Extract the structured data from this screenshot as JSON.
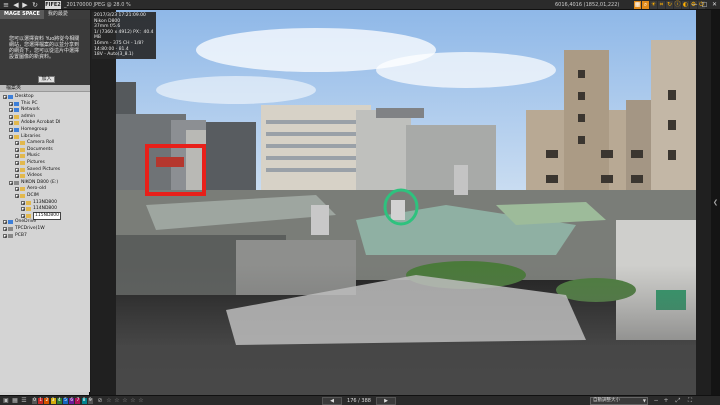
{
  "topbar": {
    "mode_label": "FIFE2",
    "file_title": "_20170000 JPEG @ 28.0 %",
    "image_info": "6016,4016 (1852,01,222)",
    "tool_icons": [
      "grid-icon",
      "zoom-icon",
      "sun-icon",
      "crop-icon",
      "rotate-icon",
      "info-icon",
      "palette-icon",
      "settings-icon",
      "exit-icon"
    ],
    "win_buttons": [
      "—",
      "□",
      "✕"
    ]
  },
  "left_panel": {
    "tabs": [
      "MAGE SPACE",
      "我的最愛"
    ],
    "note_text": "您可以選擇資料 Yuo將從今相關網站，您選擇檔案的以並分享到的網頁下，您可以從這片中選擇設置圖像的新資料。",
    "note_button": "加入",
    "tree_header": "檔案夾",
    "tree": [
      {
        "label": "Desktop",
        "depth": 0,
        "icon": "blue"
      },
      {
        "label": "This PC",
        "depth": 1,
        "icon": "blue"
      },
      {
        "label": "Network",
        "depth": 1,
        "icon": "blue"
      },
      {
        "label": "admin",
        "depth": 1,
        "icon": "yellow"
      },
      {
        "label": "Adobe Acrobat DI",
        "depth": 1,
        "icon": "yellow"
      },
      {
        "label": "Homegroup",
        "depth": 1,
        "icon": "blue"
      },
      {
        "label": "Libraries",
        "depth": 1,
        "icon": "yellow"
      },
      {
        "label": "Camera Roll",
        "depth": 2,
        "icon": "yellow"
      },
      {
        "label": "Documents",
        "depth": 2,
        "icon": "yellow"
      },
      {
        "label": "Music",
        "depth": 2,
        "icon": "yellow"
      },
      {
        "label": "Pictures",
        "depth": 2,
        "icon": "yellow"
      },
      {
        "label": "Saved Pictures",
        "depth": 2,
        "icon": "yellow"
      },
      {
        "label": "Videos",
        "depth": 2,
        "icon": "yellow"
      },
      {
        "label": "NIKON D800 (E:)",
        "depth": 1,
        "icon": "grey"
      },
      {
        "label": "Aero-old",
        "depth": 2,
        "icon": "yellow"
      },
      {
        "label": "DCIM",
        "depth": 2,
        "icon": "yellow"
      },
      {
        "label": "113ND800",
        "depth": 3,
        "icon": "yellow"
      },
      {
        "label": "114ND800",
        "depth": 3,
        "icon": "yellow"
      },
      {
        "label": "115ND800",
        "depth": 3,
        "icon": "yellow",
        "selected": true
      },
      {
        "label": "OneDrive",
        "depth": 0,
        "icon": "blue"
      },
      {
        "label": "TPCDrive(1W",
        "depth": 0,
        "icon": "grey"
      },
      {
        "label": "PCB7",
        "depth": 0,
        "icon": "grey"
      }
    ]
  },
  "info_box": {
    "lines": [
      "2017/3/23 17:21:09.00",
      "Nikon D800",
      "37mm f/5.6",
      "1/ (7360 x 4912)  PX：40.4 MB",
      "16mm - 375 CH - 1/8?",
      "14:80:00 - 81.4",
      "18V - Auto(3_8.1)"
    ]
  },
  "bottombar": {
    "ratings": [
      "0",
      "1",
      "2",
      "3",
      "4",
      "5",
      "6",
      "7",
      "8",
      "9"
    ],
    "rating_colors": [
      "#555555",
      "#c62828",
      "#d35400",
      "#d4ac0d",
      "#2e7d32",
      "#1565c0",
      "#6a1b9a",
      "#ad1457",
      "#00838f",
      "#555555"
    ],
    "stars": [
      "☆",
      "☆",
      "☆",
      "☆",
      "☆"
    ],
    "page_counter": "176 / 388",
    "zoom_label": "自動調整大小",
    "prev_label": "◀",
    "next_label": "▶"
  },
  "annotations": {
    "red_box_color": "#e8201a",
    "green_circle_color": "#2ec27e"
  }
}
